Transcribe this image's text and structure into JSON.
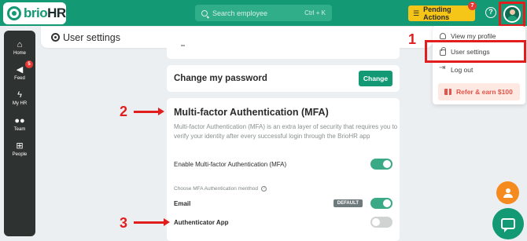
{
  "brand": {
    "name_prefix": "brio",
    "name_suffix": "HR",
    "accent": "#139a74"
  },
  "header": {
    "search_placeholder": "Search employee",
    "search_shortcut": "Ctrl + K",
    "pending_label": "Pending Actions",
    "pending_count": "7",
    "help_symbol": "?"
  },
  "sidebar": {
    "items": [
      {
        "label": "Home",
        "icon": "home-icon",
        "glyph": "⌂"
      },
      {
        "label": "Feed",
        "icon": "megaphone-icon",
        "glyph": "📢",
        "badge": "5"
      },
      {
        "label": "My HR",
        "icon": "bolt-icon",
        "glyph": "⚡"
      },
      {
        "label": "Team",
        "icon": "team-icon",
        "glyph": "👥"
      },
      {
        "label": "People",
        "icon": "org-chart-icon",
        "glyph": "⊞"
      }
    ]
  },
  "page": {
    "title": "User settings"
  },
  "password_card": {
    "title": "Change my password",
    "button_label": "Change"
  },
  "mfa": {
    "title": "Multi-factor Authentication (MFA)",
    "description": "Multi-factor Authentication (MFA) is an extra layer of security that requires you to verify your identity after every successful login through the BrioHR app",
    "enable_label": "Enable Multi-factor Authentication (MFA)",
    "enable_on": true,
    "method_heading": "Choose MFA Authentication menthod",
    "methods": [
      {
        "label": "Email",
        "badge": "DEFAULT",
        "on": true
      },
      {
        "label": "Authenticator App",
        "badge": "",
        "on": false
      }
    ]
  },
  "user_menu": {
    "items": [
      "View my profile",
      "User settings",
      "Log out"
    ],
    "refer_label": "Refer & earn $100"
  },
  "annotations": {
    "step1": "1",
    "step2": "2",
    "step3": "3",
    "color": "#e11d1d"
  }
}
